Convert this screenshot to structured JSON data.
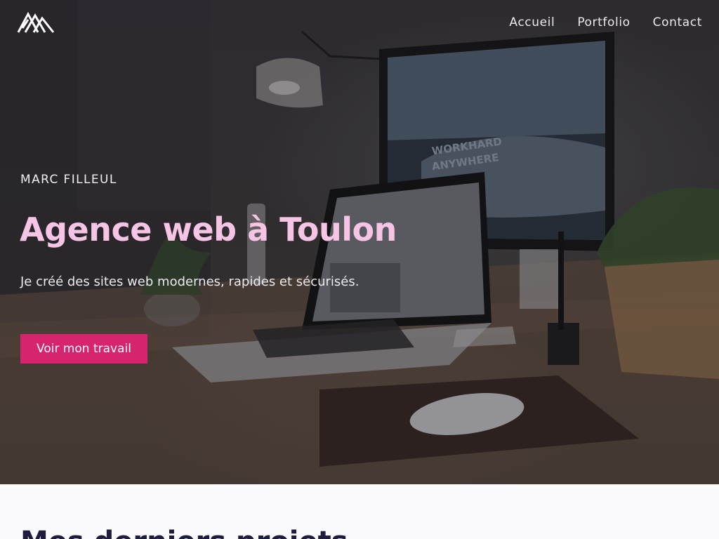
{
  "brand": {
    "logo_icon": "mountain-logo-icon"
  },
  "nav": {
    "items": [
      {
        "label": "Accueil"
      },
      {
        "label": "Portfolio"
      },
      {
        "label": "Contact"
      }
    ]
  },
  "hero": {
    "eyebrow": "MARC FILLEUL",
    "title": "Agence web à Toulon",
    "subtitle": "Je créé des sites web modernes, rapides et sécurisés.",
    "cta_label": "Voir mon travail",
    "screen_text_line1": "WORKHARD",
    "screen_text_line2": "ANYWHERE"
  },
  "section": {
    "heading": "Mes derniers projets"
  },
  "colors": {
    "accent": "#d6246f",
    "title_pink": "#f6c4e4",
    "dark_navy": "#1f1d3d"
  }
}
